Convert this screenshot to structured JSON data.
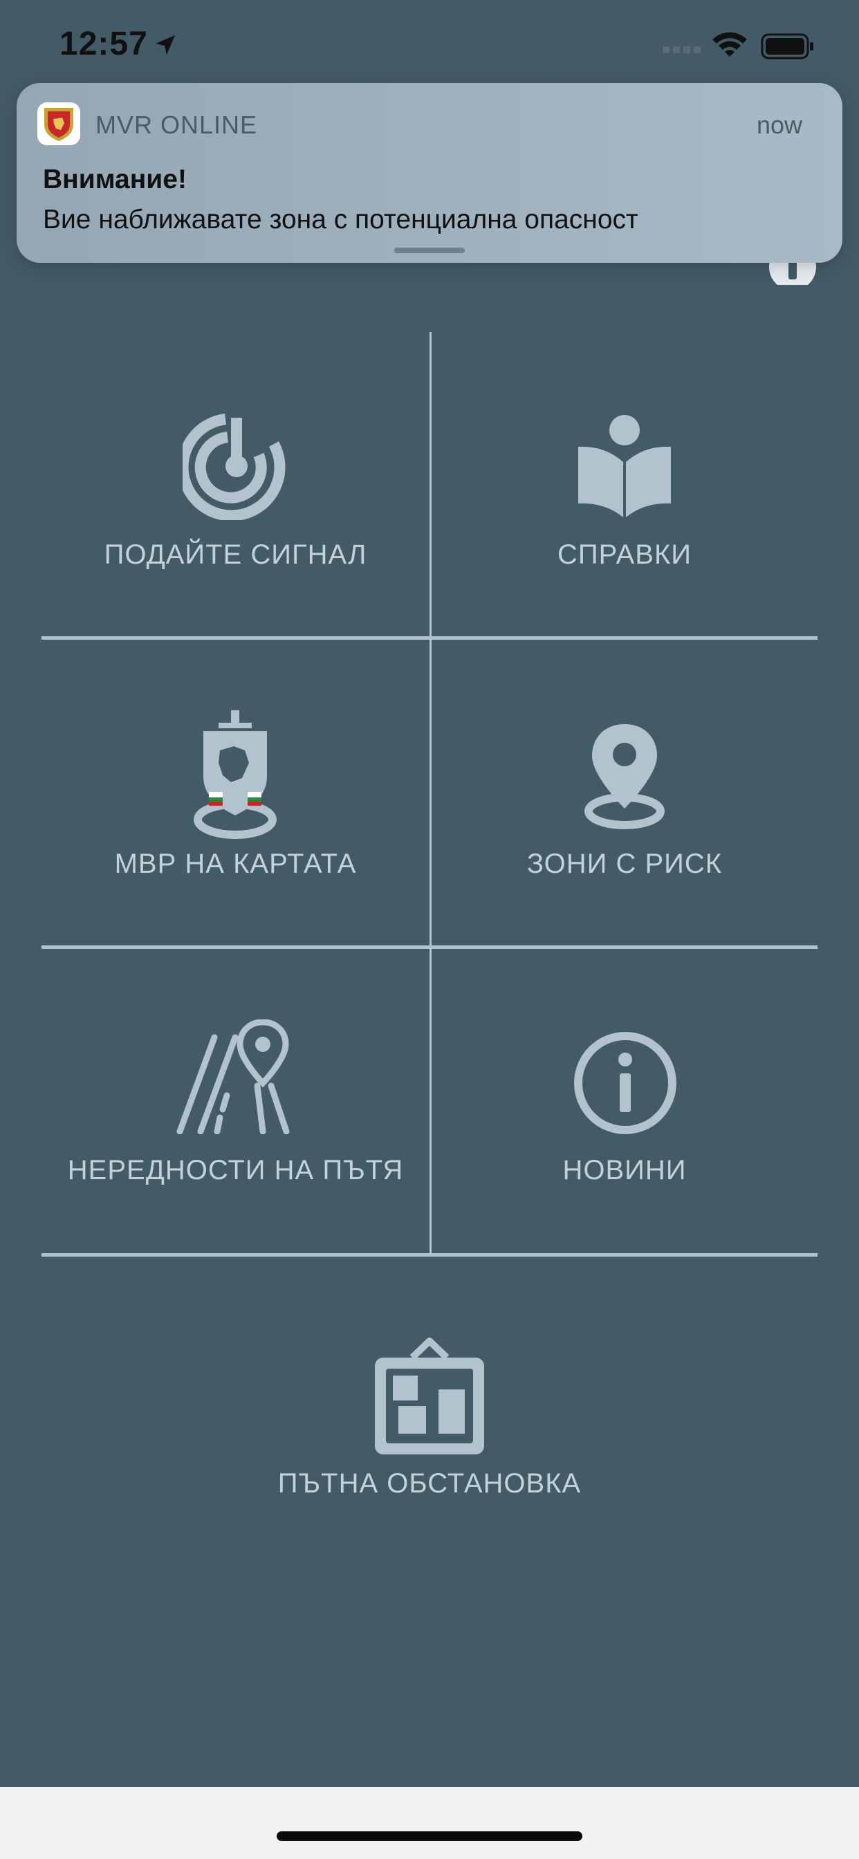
{
  "status_bar": {
    "time": "12:57",
    "icons": [
      "location-arrow-icon",
      "cellular-signal-icon",
      "wifi-icon",
      "battery-icon"
    ]
  },
  "notification": {
    "app_name": "MVR ONLINE",
    "time": "now",
    "title": "Внимание!",
    "body": "Вие наближавате зона с потенциална опасност",
    "app_icon": "mvr-crest-icon"
  },
  "menu": {
    "items": [
      {
        "label": "ПОДАЙТЕ СИГНАЛ",
        "icon": "radar-signal-icon"
      },
      {
        "label": "СПРАВКИ",
        "icon": "open-book-reader-icon"
      },
      {
        "label": "МВР НА КАРТАТА",
        "icon": "mvr-emblem-map-icon"
      },
      {
        "label": "ЗОНИ С РИСК",
        "icon": "map-pin-icon"
      },
      {
        "label": "НЕРЕДНОСТИ НА ПЪТЯ",
        "icon": "road-pin-icon"
      },
      {
        "label": "НОВИНИ",
        "icon": "info-circle-icon"
      },
      {
        "label": "ПЪТНА ОБСТАНОВКА",
        "icon": "road-situation-board-icon"
      }
    ]
  },
  "colors": {
    "background": "#435a67",
    "menu_icon": "#b3c3cd",
    "menu_label": "#c4d1d8",
    "notification_bg": "#a1b3bf"
  }
}
